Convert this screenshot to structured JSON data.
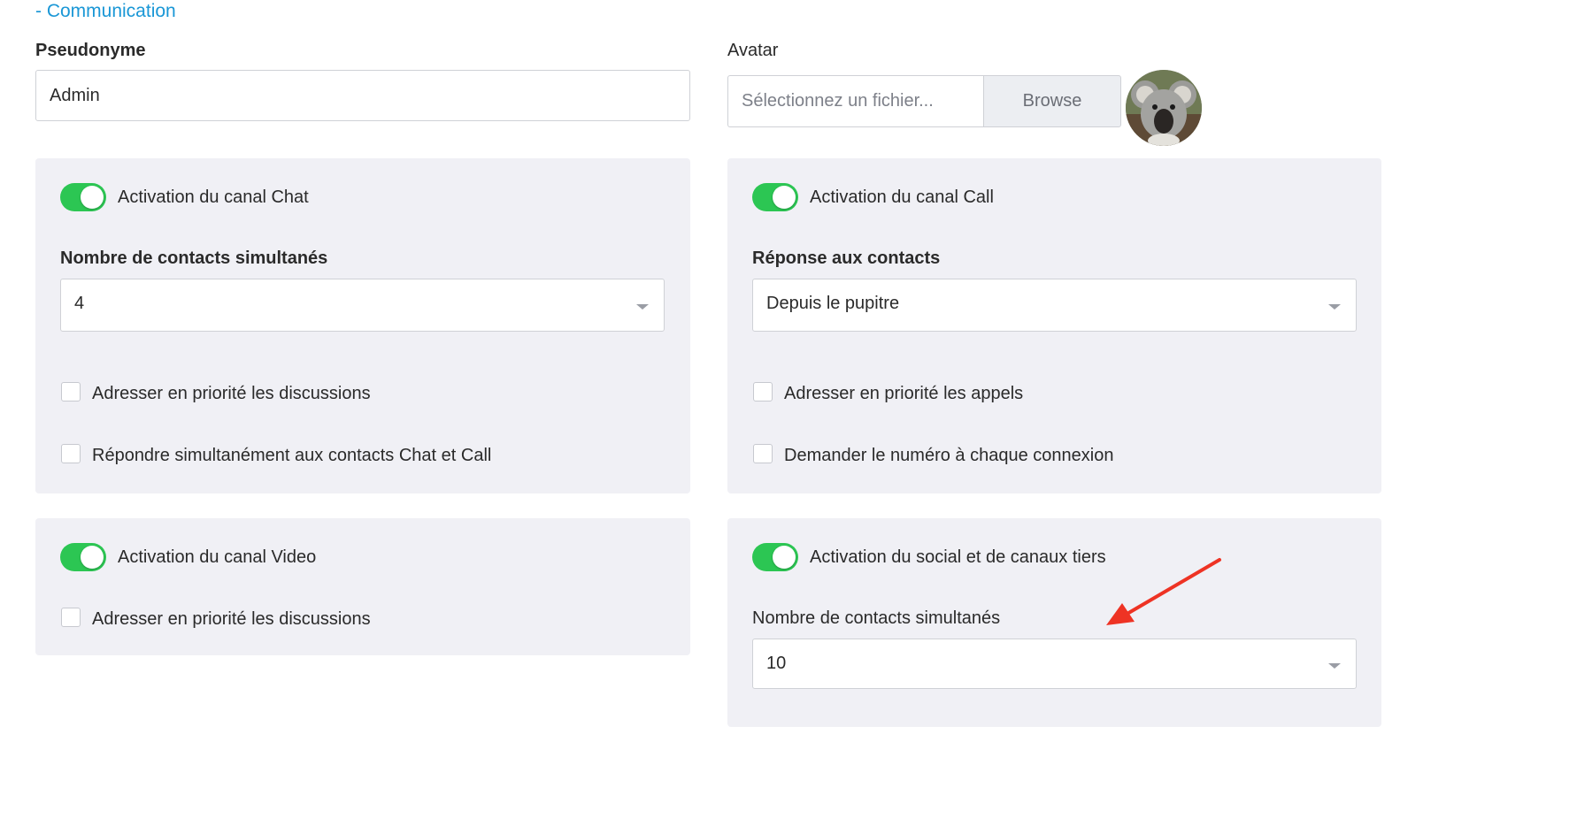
{
  "section_link": "- Communication",
  "pseudonyme": {
    "label": "Pseudonyme",
    "value": "Admin"
  },
  "avatar": {
    "label": "Avatar",
    "placeholder": "Sélectionnez un fichier...",
    "browse_label": "Browse"
  },
  "chat_panel": {
    "toggle_label": "Activation du canal Chat",
    "toggle_on": true,
    "select_label": "Nombre de contacts simultanés",
    "select_value": "4",
    "checkbox1": "Adresser en priorité les discussions",
    "checkbox2": "Répondre simultanément aux contacts Chat et Call"
  },
  "call_panel": {
    "toggle_label": "Activation du canal Call",
    "toggle_on": true,
    "select_label": "Réponse aux contacts",
    "select_value": "Depuis le pupitre",
    "checkbox1": "Adresser en priorité les appels",
    "checkbox2": "Demander le numéro à chaque connexion"
  },
  "video_panel": {
    "toggle_label": "Activation du canal Video",
    "toggle_on": true,
    "checkbox1": "Adresser en priorité les discussions"
  },
  "social_panel": {
    "toggle_label": "Activation du social et de canaux tiers",
    "toggle_on": true,
    "select_label": "Nombre de contacts simultanés",
    "select_value": "10"
  },
  "colors": {
    "accent_link": "#1a97d6",
    "toggle_on": "#2cc653",
    "panel_bg": "#f0f0f5",
    "annotation_arrow": "#ee3324"
  }
}
